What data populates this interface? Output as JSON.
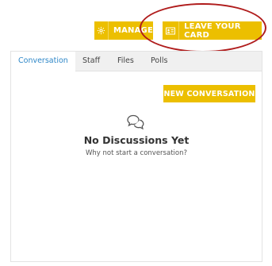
{
  "toolbar": {
    "manage_label": "MANAGE",
    "leave_card_label": "LEAVE YOUR CARD"
  },
  "tabs": [
    {
      "label": "Conversation",
      "active": true
    },
    {
      "label": "Staff",
      "active": false
    },
    {
      "label": "Files",
      "active": false
    },
    {
      "label": "Polls",
      "active": false
    }
  ],
  "main": {
    "new_conversation_label": "NEW CONVERSATION",
    "empty_title": "No Discussions Yet",
    "empty_subtitle": "Why not start a conversation?"
  },
  "icons": {
    "manage": "gear-icon",
    "card": "id-card-icon",
    "empty": "chat-bubbles-icon"
  },
  "colors": {
    "accent": "#ecbf00",
    "active_tab": "#2e87c8",
    "annotation": "#b01c1c"
  }
}
